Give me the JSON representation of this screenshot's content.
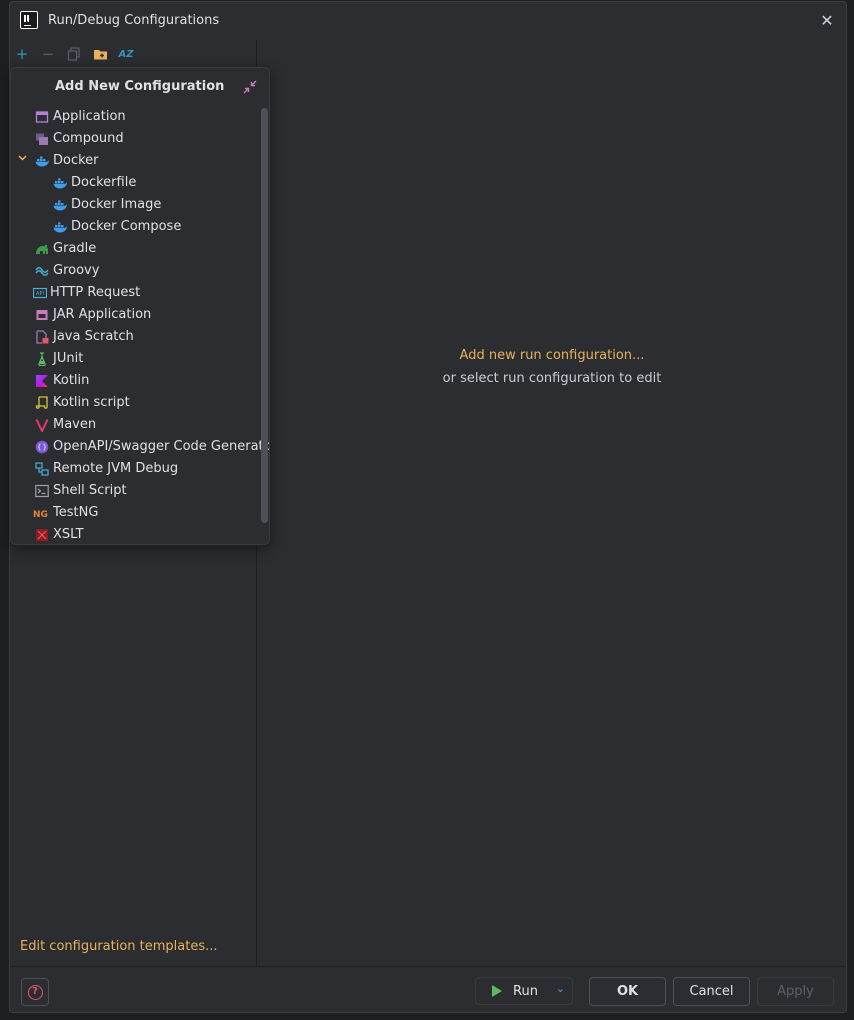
{
  "window": {
    "title": "Run/Debug Configurations"
  },
  "toolbar": {
    "add": "+",
    "remove": "−",
    "sort": "AZ"
  },
  "popup": {
    "title": "Add New Configuration",
    "items": [
      {
        "label": "Application",
        "icon": "application-icon",
        "level": 0
      },
      {
        "label": "Compound",
        "icon": "compound-icon",
        "level": 0
      },
      {
        "label": "Docker",
        "icon": "docker-icon",
        "level": 0,
        "expanded": true
      },
      {
        "label": "Dockerfile",
        "icon": "docker-icon",
        "level": 1
      },
      {
        "label": "Docker Image",
        "icon": "docker-icon",
        "level": 1
      },
      {
        "label": "Docker Compose",
        "icon": "docker-icon",
        "level": 1
      },
      {
        "label": "Gradle",
        "icon": "gradle-icon",
        "level": 0
      },
      {
        "label": "Groovy",
        "icon": "groovy-icon",
        "level": 0
      },
      {
        "label": "HTTP Request",
        "icon": "http-request-icon",
        "level": 0
      },
      {
        "label": "JAR Application",
        "icon": "jar-application-icon",
        "level": 0
      },
      {
        "label": "Java Scratch",
        "icon": "java-scratch-icon",
        "level": 0
      },
      {
        "label": "JUnit",
        "icon": "junit-icon",
        "level": 0
      },
      {
        "label": "Kotlin",
        "icon": "kotlin-icon",
        "level": 0
      },
      {
        "label": "Kotlin script",
        "icon": "kotlin-script-icon",
        "level": 0
      },
      {
        "label": "Maven",
        "icon": "maven-icon",
        "level": 0
      },
      {
        "label": "OpenAPI/Swagger Code Generator",
        "icon": "openapi-icon",
        "level": 0
      },
      {
        "label": "Remote JVM Debug",
        "icon": "remote-jvm-debug-icon",
        "level": 0
      },
      {
        "label": "Shell Script",
        "icon": "shell-script-icon",
        "level": 0
      },
      {
        "label": "TestNG",
        "icon": "testng-icon",
        "level": 0
      },
      {
        "label": "XSLT",
        "icon": "xslt-icon",
        "level": 0
      }
    ]
  },
  "left": {
    "edit_templates": "Edit configuration templates..."
  },
  "right": {
    "empty_primary": "Add new run configuration...",
    "empty_secondary": "or select run configuration to edit"
  },
  "footer": {
    "run_label": "Run",
    "ok_label": "OK",
    "cancel_label": "Cancel",
    "apply_label": "Apply"
  },
  "colors": {
    "link": "#e8b25b",
    "background": "#2b2d30",
    "text": "#dfe1e5",
    "accent_blue": "#3592c4",
    "run_green": "#5fb865"
  }
}
